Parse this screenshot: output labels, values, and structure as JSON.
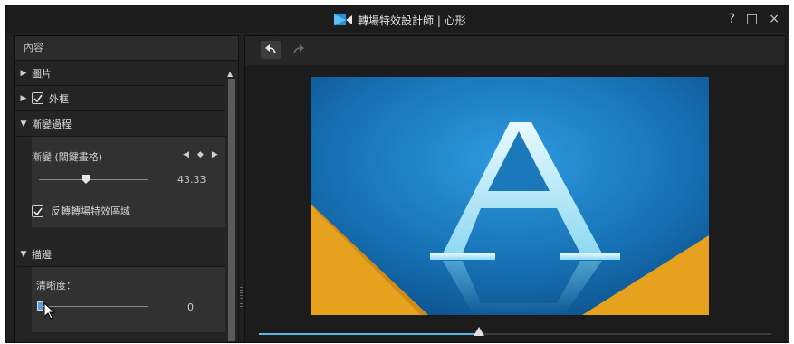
{
  "window": {
    "title": "轉場特效設計師 | 心形",
    "buttons": {
      "help": "?",
      "maximize": "□",
      "close": "×"
    }
  },
  "left_panel": {
    "header": "內容",
    "sections": {
      "image": {
        "label": "圖片",
        "expanded": false
      },
      "frame": {
        "label": "外框",
        "expanded": false,
        "checked": true
      },
      "transition": {
        "label": "漸變過程",
        "expanded": true,
        "progress_label": "漸變 (關鍵畫格)",
        "progress_value": "43.33",
        "progress_fraction": 0.4333,
        "reverse_label": "反轉轉場特效區域",
        "reverse_checked": true
      },
      "stroke": {
        "label": "描邊",
        "expanded": true,
        "sharpness_label": "清晰度：",
        "sharpness_value": "0",
        "sharpness_fraction": 0.0
      }
    }
  },
  "toolbar": {
    "undo": "undo-icon",
    "redo": "redo-icon"
  },
  "preview": {
    "letter": "A"
  },
  "timeline": {
    "position_fraction": 0.43
  },
  "colors": {
    "accent": "#5ab4e6",
    "preview_blue": "#1a7fc1",
    "preview_orange": "#e6a21f"
  }
}
